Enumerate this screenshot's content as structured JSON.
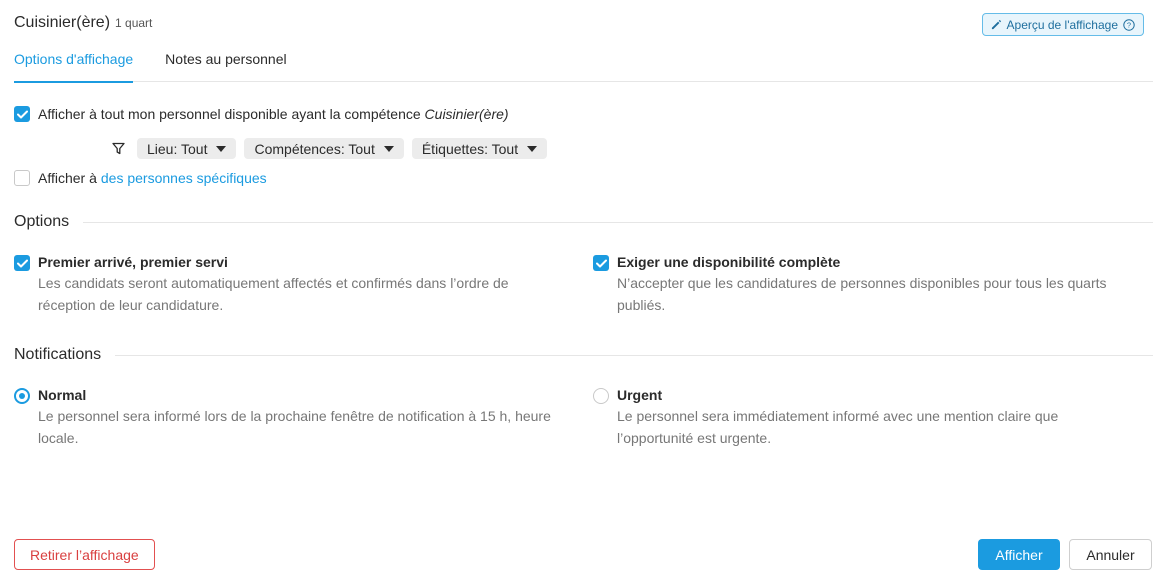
{
  "header": {
    "title": "Cuisinier(ère)",
    "subtitle": "1 quart"
  },
  "preview_button": {
    "label": "Aperçu de l'affichage",
    "icon": "pencil-icon",
    "help_icon": "help-circle-icon"
  },
  "tabs": [
    {
      "label": "Options d'affichage",
      "active": true
    },
    {
      "label": "Notes au personnel",
      "active": false
    }
  ],
  "audience": {
    "all_staff": {
      "checked": true,
      "label_prefix": "Afficher à tout mon personnel disponible ayant la compétence ",
      "label_skill": "Cuisinier(ère)"
    },
    "filters": [
      {
        "label": "Lieu: Tout"
      },
      {
        "label": "Compétences: Tout"
      },
      {
        "label": "Étiquettes: Tout"
      }
    ],
    "specific": {
      "checked": false,
      "label_prefix": "Afficher à",
      "link": "des personnes spécifiques"
    }
  },
  "options": {
    "heading": "Options",
    "first_come": {
      "checked": true,
      "title": "Premier arrivé, premier servi",
      "desc": "Les candidats seront automatiquement affectés et confirmés dans l’ordre de réception de leur candidature."
    },
    "full_availability": {
      "checked": true,
      "title": "Exiger une disponibilité complète",
      "desc": "N’accepter que les candidatures de personnes disponibles pour tous les quarts publiés."
    }
  },
  "notifications": {
    "heading": "Notifications",
    "normal": {
      "selected": true,
      "title": "Normal",
      "desc": "Le personnel sera informé lors de la prochaine fenêtre de notification à 15 h, heure locale."
    },
    "urgent": {
      "selected": false,
      "title": "Urgent",
      "desc": "Le personnel sera immédiatement informé avec une mention claire que l’opportunité est urgente."
    }
  },
  "footer": {
    "remove_label": "Retirer l’affichage",
    "submit_label": "Afficher",
    "cancel_label": "Annuler"
  },
  "colors": {
    "accent": "#1b9be0",
    "danger": "#d94040",
    "muted_text": "#777777"
  }
}
